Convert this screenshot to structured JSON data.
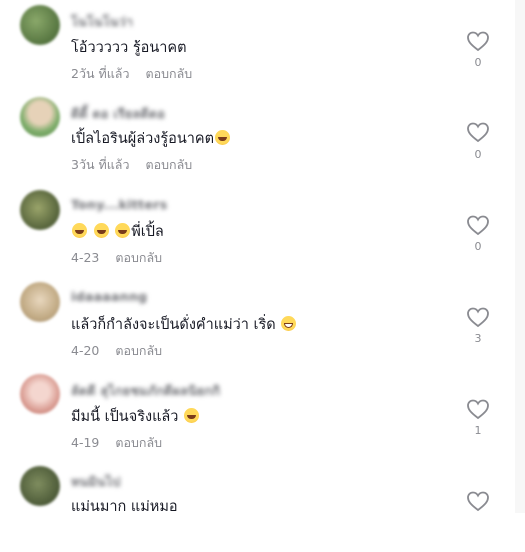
{
  "comments": [
    {
      "username": "โนโนโนว่า",
      "text": "โอ้ววววว รู้อนาคต",
      "emoji": "",
      "time": "2วัน ที่แล้ว",
      "reply": "ตอบกลับ",
      "likes": "0",
      "avatar_color": "#4f7a3a"
    },
    {
      "username": "ดีดี้ ดอ เรียลดีดอ",
      "text": "เปิ้ลไอรินผู้ล่วงรู้อนาคต",
      "emoji": "laughing",
      "time": "3วัน ที่แล้ว",
      "reply": "ตอบกลับ",
      "likes": "0",
      "avatar_color": "#8fb37a"
    },
    {
      "username": "Tony...kitters",
      "text": "พี่เปิ้ล",
      "emoji": "laughing-x3-before",
      "time": "4-23",
      "reply": "ตอบกลับ",
      "likes": "0",
      "avatar_color": "#6d7a4a"
    },
    {
      "username": "idaaaanng",
      "text": "แล้วก็กำลังจะเป็นดั่งคำแม่ว่า เริ่ด",
      "emoji": "grinning",
      "time": "4-20",
      "reply": "ตอบกลับ",
      "likes": "3",
      "avatar_color": "#c9b392"
    },
    {
      "username": "ลัดดี สุไกยชมภักดีผลนิยกกิ",
      "text": "มีมนี้ เป็นจริงแล้ว",
      "emoji": "laughing",
      "time": "4-19",
      "reply": "ตอบกลับ",
      "likes": "1",
      "avatar_color": "#d4a59a"
    },
    {
      "username": "หนมินไป",
      "text": "แม่นมาก แม่หมอ",
      "emoji": "",
      "time": "",
      "reply": "",
      "likes": "",
      "avatar_color": "#5a6b45"
    }
  ],
  "icons": {
    "like": "heart-outline-icon"
  },
  "colors": {
    "text": "#161823",
    "meta": "#8a8b91",
    "heart": "#8a8b91"
  }
}
